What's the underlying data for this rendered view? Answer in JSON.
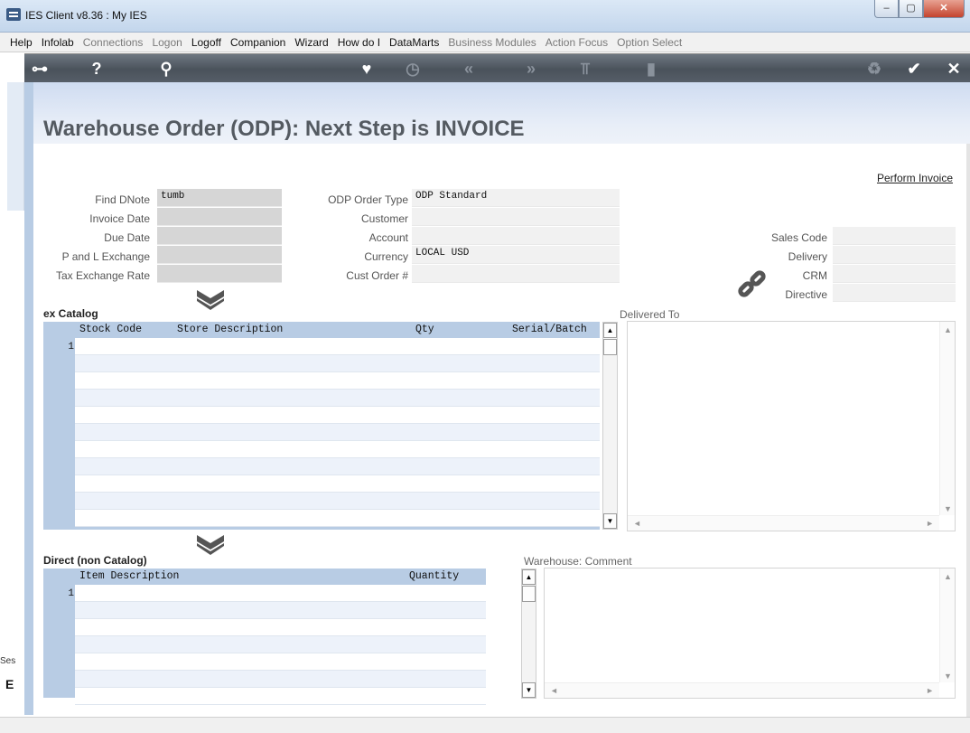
{
  "window": {
    "title": "IES Client v8.36 : My IES",
    "min": "–",
    "max": "▢",
    "close": "✕"
  },
  "menu": [
    {
      "label": "Help",
      "enabled": true
    },
    {
      "label": "Infolab",
      "enabled": true
    },
    {
      "label": "Connections",
      "enabled": false
    },
    {
      "label": "Logon",
      "enabled": false
    },
    {
      "label": "Logoff",
      "enabled": true
    },
    {
      "label": "Companion",
      "enabled": true
    },
    {
      "label": "Wizard",
      "enabled": true
    },
    {
      "label": "How do I",
      "enabled": true
    },
    {
      "label": "DataMarts",
      "enabled": true
    },
    {
      "label": "Business Modules",
      "enabled": false
    },
    {
      "label": "Action Focus",
      "enabled": false
    },
    {
      "label": "Option Select",
      "enabled": false
    }
  ],
  "toolbar": {
    "key": "⊶",
    "help": "?",
    "search": "⚲",
    "heart": "♥",
    "clock": "◷",
    "back": "«",
    "forward": "»",
    "tools": "⫪",
    "stop": "▮",
    "recycle": "♻",
    "ok": "✔",
    "close": "✕"
  },
  "page": {
    "title": "Warehouse Order (ODP): Next Step is INVOICE",
    "perform_link": "Perform Invoice"
  },
  "form": {
    "find_dnote": {
      "label": "Find DNote",
      "value": "tumb"
    },
    "invoice_date": {
      "label": "Invoice Date",
      "value": ""
    },
    "due_date": {
      "label": "Due Date",
      "value": ""
    },
    "pl_exchange": {
      "label": "P and L Exchange",
      "value": ""
    },
    "tax_exchange": {
      "label": "Tax Exchange Rate",
      "value": ""
    },
    "order_type": {
      "label": "ODP Order Type",
      "value": "ODP Standard"
    },
    "customer": {
      "label": "Customer",
      "value": ""
    },
    "account": {
      "label": "Account",
      "value": ""
    },
    "currency": {
      "label": "Currency",
      "value": "LOCAL USD"
    },
    "cust_order": {
      "label": "Cust Order #",
      "value": ""
    },
    "sales_code": {
      "label": "Sales Code",
      "value": ""
    },
    "delivery": {
      "label": "Delivery",
      "value": ""
    },
    "crm": {
      "label": "CRM",
      "value": ""
    },
    "directive": {
      "label": "Directive",
      "value": ""
    }
  },
  "catalog": {
    "title": "ex Catalog",
    "columns": [
      "Stock Code",
      "Store Description",
      "Qty",
      "Serial/Batch"
    ],
    "row_number": "1"
  },
  "delivered_to": {
    "label": "Delivered To",
    "value": ""
  },
  "direct": {
    "title": "Direct (non Catalog)",
    "columns": [
      "Item Description",
      "Quantity"
    ],
    "row_number": "1"
  },
  "warehouse_comment": {
    "label": "Warehouse: Comment",
    "value": ""
  },
  "side": {
    "ses": "Ses",
    "ses_icon": "E"
  },
  "scroll": {
    "up": "▲",
    "down": "▼",
    "left": "◄",
    "right": "►"
  }
}
